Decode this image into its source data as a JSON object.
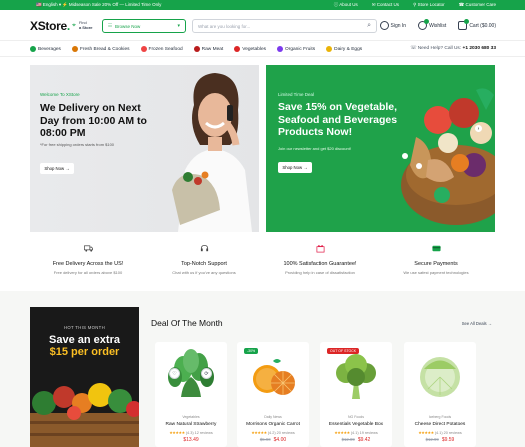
{
  "topbar": {
    "language": "English",
    "promo": "Midseason Sale 20% Off — Limited Time Only",
    "links": [
      "About Us",
      "Contact Us",
      "Store Locator",
      "Customer Care"
    ]
  },
  "header": {
    "logo_main": "XStore",
    "location_line1": "Find",
    "location_line2": "a Store",
    "browse_label": "Browse Now",
    "search_placeholder": "What are you looking for...",
    "signin": "Sign In",
    "wishlist": "Wishlist",
    "cart": "Cart ($0.00)"
  },
  "categories": [
    {
      "label": "Beverages",
      "color": "#16a34a"
    },
    {
      "label": "Fresh Bread & Cookies",
      "color": "#d97706"
    },
    {
      "label": "Frozen Seafood",
      "color": "#ef4444"
    },
    {
      "label": "Raw Meat",
      "color": "#b91c1c"
    },
    {
      "label": "Vegetables",
      "color": "#dc2626"
    },
    {
      "label": "Organic Fruits",
      "color": "#7c3aed"
    },
    {
      "label": "Dairy & Eggs",
      "color": "#eab308"
    }
  ],
  "helpline": {
    "text": "Need Help? Call Us:",
    "number": "+1 2030 680 33"
  },
  "hero_left": {
    "kicker": "Welcome To XStore",
    "title": "We Delivery on Next Day from 10:00 AM to 08:00 PM",
    "subtitle": "*For free shipping orders starts from $100",
    "button": "Shop Now →"
  },
  "hero_right": {
    "kicker": "Limited Time Deal",
    "title": "Save 15% on Vegetable, Seafood and Beverages Products Now!",
    "subtitle": "Join our newsletter and get $20 discount!",
    "button": "Shop Now →"
  },
  "features": [
    {
      "title": "Free Delivery Across the US!",
      "desc": "Free delivery for all orders above $100",
      "icon": "truck-icon"
    },
    {
      "title": "Top-Notch Support",
      "desc": "Chat with us if you've any questions",
      "icon": "headset-icon"
    },
    {
      "title": "100% Satisfaction Guarantee!",
      "desc": "Providing help in case of dissatisfaction",
      "icon": "heart-gift-icon"
    },
    {
      "title": "Secure Payments",
      "desc": "We use safest payment technologies",
      "icon": "card-icon"
    }
  ],
  "promo": {
    "kicker": "HOT THIS MONTH",
    "line1": "Save an extra",
    "line2": "$15 per order"
  },
  "deal": {
    "title": "Deal Of The Month",
    "view_all": "See All Deals →"
  },
  "products": [
    {
      "vendor": "Vegetables",
      "name": "Raw Natural Strawberry",
      "stars": "★★★★★",
      "reviews": "(4.3) 12 reviews",
      "old": "",
      "price": "$13.49",
      "badge": "",
      "badge_color": ""
    },
    {
      "vendor": "Daily News",
      "name": "Morrisons Organic Carrot",
      "stars": "★★★★★",
      "reviews": "(4.2) 20 reviews",
      "old": "$5.90",
      "price": "$4.00",
      "badge": "-30%",
      "badge_color": "#16a34a"
    },
    {
      "vendor": "NG Foods",
      "name": "Essentials Vegetable Box",
      "stars": "★★★★★",
      "reviews": "(4.1) 19 reviews",
      "old": "$12.89",
      "price": "$9.42",
      "badge": "OUT OF STOCK",
      "badge_color": "#dc2626"
    },
    {
      "vendor": "Iceberg Foods",
      "name": "Cheese Direct Potatoes",
      "stars": "★★★★★",
      "reviews": "(4.1) 20 reviews",
      "old": "$12.99",
      "price": "$9.59",
      "badge": "",
      "badge_color": ""
    }
  ]
}
